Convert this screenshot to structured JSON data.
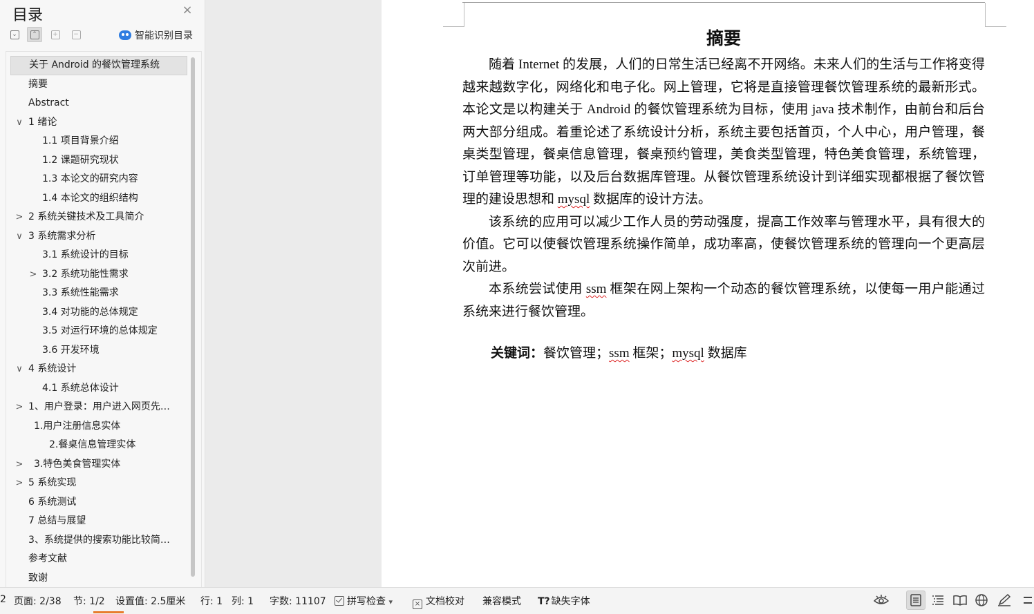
{
  "nav": {
    "title": "目录",
    "close_glyph": "×",
    "smart_toc_label": "智能识别目录",
    "toc": [
      {
        "label": "关于 Android 的餐饮管理系统",
        "level": 1,
        "arrow": "",
        "selected": true
      },
      {
        "label": "摘要",
        "level": 1,
        "arrow": ""
      },
      {
        "label": "Abstract",
        "level": 1,
        "arrow": ""
      },
      {
        "label": "1  绪论",
        "level": 1,
        "arrow": "∨"
      },
      {
        "label": "1.1 项目背景介绍",
        "level": 2,
        "arrow": ""
      },
      {
        "label": "1.2 课题研究现状",
        "level": 2,
        "arrow": ""
      },
      {
        "label": "1.3 本论文的研究内容",
        "level": 2,
        "arrow": ""
      },
      {
        "label": "1.4 本论文的组织结构",
        "level": 2,
        "arrow": ""
      },
      {
        "label": "2 系统关键技术及工具简介",
        "level": 1,
        "arrow": ">"
      },
      {
        "label": "3 系统需求分析",
        "level": 1,
        "arrow": "∨"
      },
      {
        "label": "3.1 系统设计的目标",
        "level": 2,
        "arrow": ""
      },
      {
        "label": "3.2 系统功能性需求",
        "level": 2,
        "arrow": ">"
      },
      {
        "label": "3.3 系统性能需求",
        "level": 2,
        "arrow": ""
      },
      {
        "label": "3.4 对功能的总体规定",
        "level": 2,
        "arrow": ""
      },
      {
        "label": "3.5 对运行环境的总体规定",
        "level": 2,
        "arrow": ""
      },
      {
        "label": "3.6 开发环境",
        "level": 2,
        "arrow": ""
      },
      {
        "label": "4 系统设计",
        "level": 1,
        "arrow": "∨"
      },
      {
        "label": "4.1 系统总体设计",
        "level": 2,
        "arrow": ""
      },
      {
        "label": "1、用户登录：用户进入网页先…",
        "level": 1,
        "arrow": ">"
      },
      {
        "label": "1.用户注册信息实体",
        "level": 1.5,
        "arrow": ""
      },
      {
        "label": "2.餐桌信息管理实体",
        "level": 2.5,
        "arrow": ""
      },
      {
        "label": "3.特色美食管理实体",
        "level": 1.5,
        "arrow": ">"
      },
      {
        "label": "5 系统实现",
        "level": 1,
        "arrow": ">"
      },
      {
        "label": "6 系统测试",
        "level": 1,
        "arrow": ""
      },
      {
        "label": "7 总结与展望",
        "level": 1,
        "arrow": ""
      },
      {
        "label": "3、系统提供的搜索功能比较简…",
        "level": 1,
        "arrow": ""
      },
      {
        "label": "参考文献",
        "level": 1,
        "arrow": ""
      },
      {
        "label": "致谢",
        "level": 1,
        "arrow": ""
      }
    ]
  },
  "document": {
    "heading": "摘要",
    "p1": [
      {
        "t": "随着 Internet 的发展，人们的日常生活已经离不开网络。未来人们的生活与工作将变得越来越数字化，网络化和电子化。网上管理，它将是直接管理餐饮管理系统的最新形式。本论文是以构建关于 Android 的餐饮管理系统为目标，使用 java 技术制作，由前台和后台两大部分组成。着重论述了系统设计分析，系统主要包括首页，个人中心，用户管理，餐桌类型管理，餐桌信息管理，餐桌预约管理，美食类型管理，特色美食管理，系统管理，订单管理等功能，以及后台数据库管理。从餐饮管理系统设计到详细实现都根据了餐饮管理的建设思想和 ",
        "sq": false
      },
      {
        "t": "mysql",
        "sq": true
      },
      {
        "t": " 数据库的设计方法。",
        "sq": false
      }
    ],
    "p2": "该系统的应用可以减少工作人员的劳动强度，提高工作效率与管理水平，具有很大的价值。它可以使餐饮管理系统操作简单，成功率高，使餐饮管理系统的管理向一个更高层次前进。",
    "p3": [
      {
        "t": "本系统尝试使用 ",
        "sq": false
      },
      {
        "t": "ssm",
        "sq": true
      },
      {
        "t": " 框架在网上架构一个动态的餐饮管理系统，以使每一用户能通过系统来进行餐饮管理。",
        "sq": false
      }
    ],
    "keywords_label": "关键词：",
    "keywords": [
      {
        "t": "餐饮管理；",
        "sq": false
      },
      {
        "t": "ssm",
        "sq": true
      },
      {
        "t": " 框架；",
        "sq": false
      },
      {
        "t": "mysql",
        "sq": true
      },
      {
        "t": " 数据库",
        "sq": false
      }
    ]
  },
  "status": {
    "left_cut": "2",
    "page": "页面: 2/38",
    "section": "节: 1/2",
    "setting": "设置值: 2.5厘米",
    "row": "行: 1",
    "col": "列: 1",
    "words": "字数: 11107",
    "spell": "拼写检查",
    "spell_arrow": "▾",
    "proof": "文档校对",
    "compat": "兼容模式",
    "missing_font": "缺失字体",
    "missing_font_glyph": "T?"
  },
  "icons": {
    "eye": "eye-icon",
    "page_view": "page-view-icon",
    "outline_view": "outline-view-icon",
    "read_view": "reading-view-icon",
    "web_view": "web-view-icon",
    "pen": "pen-icon"
  }
}
